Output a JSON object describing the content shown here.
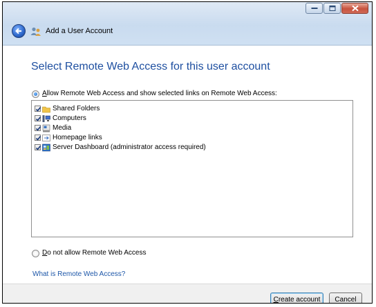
{
  "window": {
    "title": "Add a User Account",
    "controls": [
      "minimize",
      "maximize",
      "close"
    ]
  },
  "heading": "Select Remote Web Access for this user account",
  "options": {
    "allow": {
      "accel": "A",
      "label_rest": "llow Remote Web Access and show selected links on Remote Web Access:",
      "selected": true
    },
    "deny": {
      "accel": "D",
      "label_rest": "o not allow Remote Web Access",
      "selected": false
    }
  },
  "links_list": [
    {
      "label": "Shared Folders",
      "checked": true,
      "icon": "folder-icon"
    },
    {
      "label": "Computers",
      "checked": true,
      "icon": "computers-icon"
    },
    {
      "label": "Media",
      "checked": true,
      "icon": "media-icon"
    },
    {
      "label": "Homepage links",
      "checked": true,
      "icon": "homepage-links-icon"
    },
    {
      "label": "Server Dashboard (administrator access required)",
      "checked": true,
      "icon": "server-dashboard-icon"
    }
  ],
  "help_link": "What is Remote Web Access?",
  "buttons": {
    "create": {
      "accel": "C",
      "label_rest": "reate account"
    },
    "cancel": "Cancel"
  },
  "colors": {
    "heading": "#1e4fa0",
    "link": "#1c56a8",
    "titlebar": "#c9dbef",
    "close_button": "#c7523e"
  }
}
